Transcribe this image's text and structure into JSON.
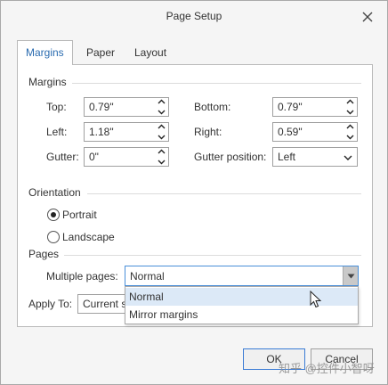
{
  "window": {
    "title": "Page Setup"
  },
  "tabs": [
    {
      "label": "Margins"
    },
    {
      "label": "Paper"
    },
    {
      "label": "Layout"
    }
  ],
  "margins": {
    "section_label": "Margins",
    "top": {
      "label": "Top:",
      "value": "0.79\""
    },
    "left": {
      "label": "Left:",
      "value": "1.18\""
    },
    "gutter": {
      "label": "Gutter:",
      "value": "0\""
    },
    "bottom": {
      "label": "Bottom:",
      "value": "0.79\""
    },
    "right": {
      "label": "Right:",
      "value": "0.59\""
    },
    "gutter_position": {
      "label": "Gutter position:",
      "value": "Left"
    }
  },
  "orientation": {
    "section_label": "Orientation",
    "portrait": {
      "label": "Portrait",
      "checked": true
    },
    "landscape": {
      "label": "Landscape",
      "checked": false
    }
  },
  "pages": {
    "section_label": "Pages",
    "multiple_pages_label": "Multiple pages:",
    "multiple_pages_value": "Normal",
    "options": [
      "Normal",
      "Mirror margins"
    ]
  },
  "apply_to": {
    "label": "Apply To:",
    "value": "Current s"
  },
  "buttons": {
    "ok": "OK",
    "cancel": "Cancel"
  },
  "watermark": "知乎 @控件小智呀",
  "colors": {
    "accent": "#2b6cb0",
    "focus_border": "#4a90d9",
    "hover": "#dce9f7"
  }
}
